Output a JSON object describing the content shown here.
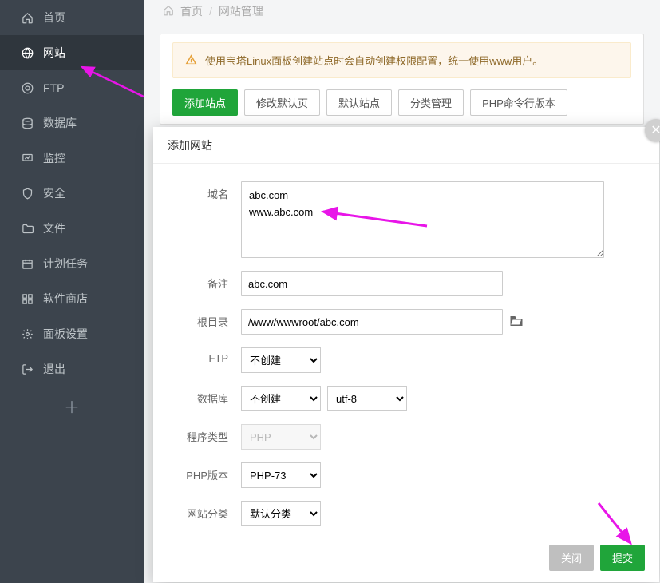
{
  "sidebar": {
    "items": [
      {
        "label": "首页",
        "icon": "home"
      },
      {
        "label": "网站",
        "icon": "globe",
        "active": true
      },
      {
        "label": "FTP",
        "icon": "ftp"
      },
      {
        "label": "数据库",
        "icon": "db"
      },
      {
        "label": "监控",
        "icon": "monitor"
      },
      {
        "label": "安全",
        "icon": "shield"
      },
      {
        "label": "文件",
        "icon": "folder"
      },
      {
        "label": "计划任务",
        "icon": "calendar"
      },
      {
        "label": "软件商店",
        "icon": "apps"
      },
      {
        "label": "面板设置",
        "icon": "gear"
      },
      {
        "label": "退出",
        "icon": "exit"
      }
    ],
    "add": "＋"
  },
  "breadcrumb": {
    "home": "首页",
    "current": "网站管理"
  },
  "notice": "使用宝塔Linux面板创建站点时会自动创建权限配置，统一使用www用户。",
  "toolbar": {
    "add": "添加站点",
    "modify_default": "修改默认页",
    "default_site": "默认站点",
    "category": "分类管理",
    "php_cli": "PHP命令行版本"
  },
  "dialog": {
    "title": "添加网站",
    "labels": {
      "domain": "域名",
      "remark": "备注",
      "root": "根目录",
      "ftp": "FTP",
      "db": "数据库",
      "type": "程序类型",
      "php": "PHP版本",
      "cat": "网站分类"
    },
    "values": {
      "domain": "abc.com\nwww.abc.com",
      "remark": "abc.com",
      "root": "/www/wwwroot/abc.com",
      "ftp": "不创建",
      "db": "不创建",
      "charset": "utf-8",
      "type": "PHP",
      "php": "PHP-73",
      "cat": "默认分类"
    },
    "footer": {
      "close": "关闭",
      "submit": "提交"
    }
  }
}
